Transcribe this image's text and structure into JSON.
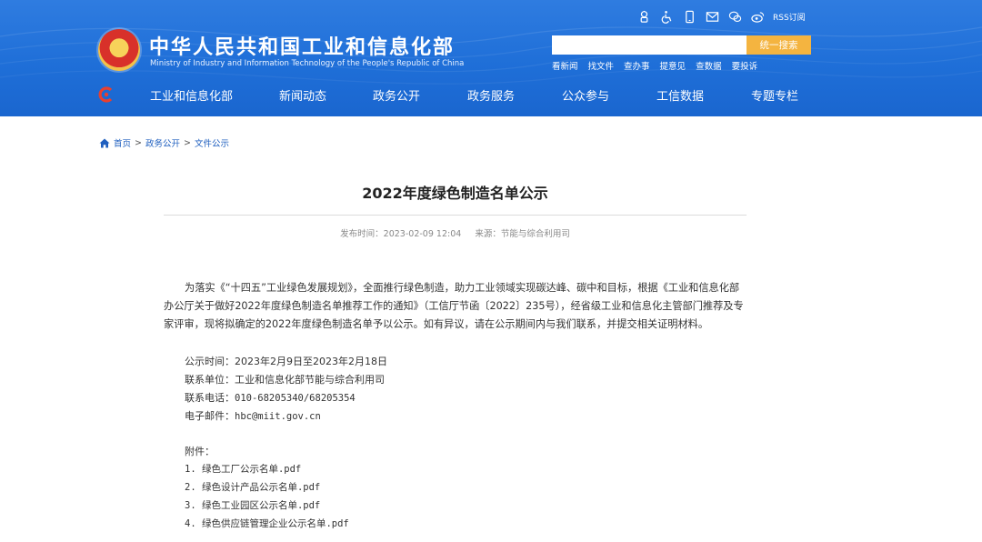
{
  "header": {
    "site_title": "中华人民共和国工业和信息化部",
    "site_subtitle": "Ministry of Industry and Information Technology of the People's Republic of China",
    "rss_label": "RSS订阅",
    "search_placeholder": "",
    "search_button": "统一搜索",
    "quick_links": [
      "看新闻",
      "找文件",
      "查办事",
      "提意见",
      "查数据",
      "要投诉"
    ],
    "colors": {
      "header_blue": "#1f6fd8",
      "search_button": "#f4b440"
    }
  },
  "nav": {
    "items": [
      "工业和信息化部",
      "新闻动态",
      "政务公开",
      "政务服务",
      "公众参与",
      "工信数据",
      "专题专栏"
    ]
  },
  "breadcrumb": {
    "items": [
      "首页",
      "政务公开",
      "文件公示"
    ],
    "separator": ">"
  },
  "article": {
    "title": "2022年度绿色制造名单公示",
    "publish_time": "发布时间：2023-02-09 12:04",
    "source": "来源：节能与综合利用司",
    "paragraph": "为落实《“十四五”工业绿色发展规划》，全面推行绿色制造，助力工业领域实现碳达峰、碳中和目标，根据《工业和信息化部办公厅关于做好2022年度绿色制造名单推荐工作的通知》（工信厅节函〔2022〕235号），经省级工业和信息化主管部门推荐及专家评审，现将拟确定的2022年度绿色制造名单予以公示。如有异议，请在公示期间内与我们联系，并提交相关证明材料。",
    "notice_period_label": "公示时间：",
    "notice_period_value": "2023年2月9日至2023年2月18日",
    "contact_unit_label": "联系单位：",
    "contact_unit_value": "工业和信息化部节能与综合利用司",
    "phone_label": "联系电话：",
    "phone_value": "010-68205340/68205354",
    "email_label": "电子邮件：",
    "email_value": "hbc@miit.gov.cn",
    "attachments_label": "附件：",
    "attachments": [
      "1. 绿色工厂公示名单.pdf",
      "2. 绿色设计产品公示名单.pdf",
      "3. 绿色工业园区公示名单.pdf",
      "4. 绿色供应链管理企业公示名单.pdf"
    ]
  },
  "icons": [
    "accessibility-robot-icon",
    "wheelchair-icon",
    "mobile-icon",
    "mail-icon",
    "wechat-icon",
    "weibo-icon"
  ]
}
